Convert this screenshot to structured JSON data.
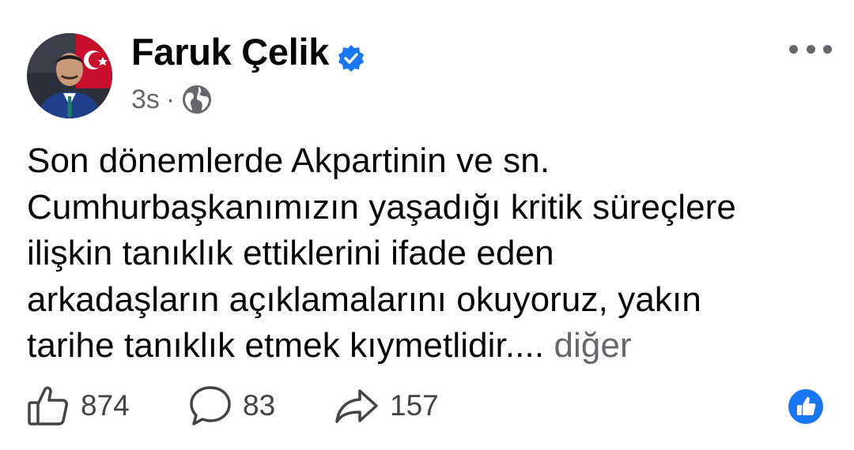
{
  "post": {
    "author": "Faruk Çelik",
    "time": "3s",
    "separator": "·",
    "text_lines": [
      "Son dönemlerde Akpartinin ve sn.",
      "Cumhurbaşkanımızın yaşadığı kritik süreçlere",
      "ilişkin tanıklık ettiklerini ifade eden",
      "arkadaşların açıklamalarını okuyoruz, yakın",
      "tarihe tanıklık etmek kıymetlidir...."
    ],
    "see_more": "diğer"
  },
  "actions": {
    "likes": "874",
    "comments": "83",
    "shares": "157"
  },
  "icons": {
    "verified": "verified-badge-icon",
    "audience": "globe-icon",
    "more": "more-options-icon",
    "like": "thumbs-up-icon",
    "comment": "comment-bubble-icon",
    "share": "share-arrow-icon",
    "reaction": "like-reaction-icon"
  },
  "colors": {
    "verified": "#1877f2",
    "secondary_text": "#65676b",
    "reaction": "#1877f2"
  }
}
